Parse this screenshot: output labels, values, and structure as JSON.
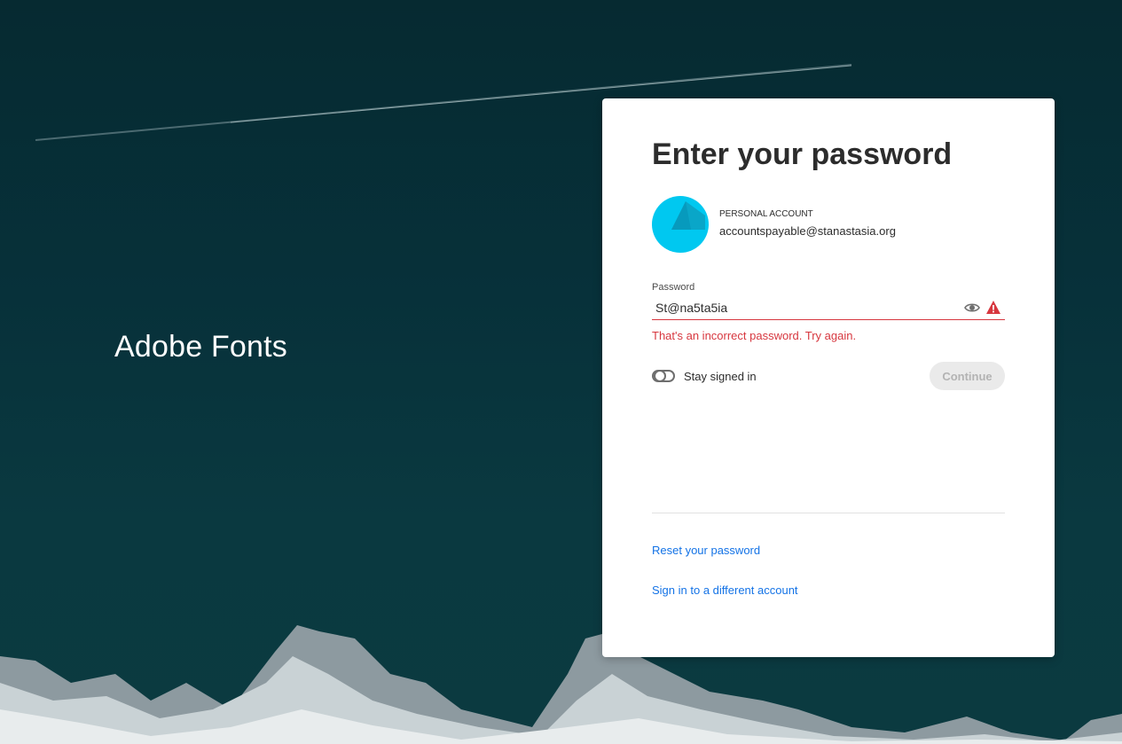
{
  "brand": {
    "name": "Adobe Fonts"
  },
  "card": {
    "title": "Enter your password",
    "account": {
      "type": "PERSONAL ACCOUNT",
      "email": "accountspayable@stanastasia.org"
    },
    "password": {
      "label": "Password",
      "value": "St@na5ta5ia",
      "error": "That's an incorrect password. Try again."
    },
    "stay_signed_in": {
      "label": "Stay signed in",
      "checked": false
    },
    "continue_label": "Continue",
    "links": {
      "reset": "Reset your password",
      "different_account": "Sign in to a different account"
    }
  },
  "colors": {
    "background": "#07313a",
    "error": "#d7373f",
    "link": "#1473e6",
    "avatar": "#00c8f0"
  },
  "icons": {
    "show_password": "eye-icon",
    "error": "alert-icon",
    "avatar": "avatar-image"
  }
}
